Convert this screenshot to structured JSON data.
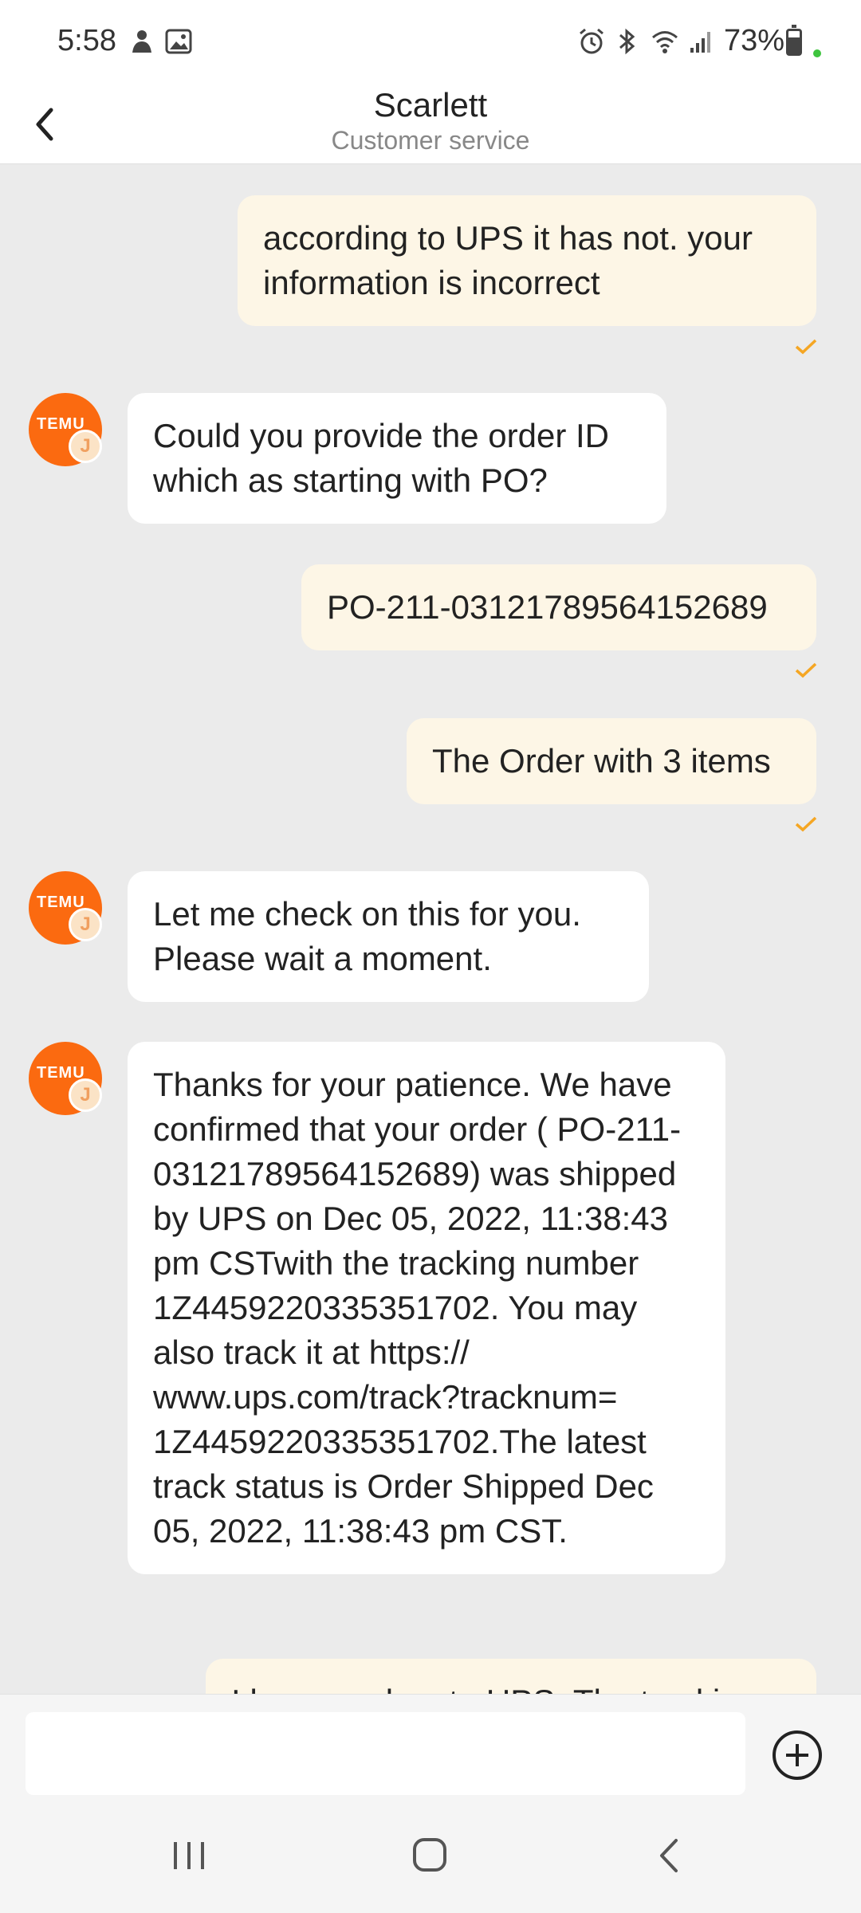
{
  "status_bar": {
    "time": "5:58",
    "battery_percent": "73%",
    "battery_level": 0.73,
    "icons": [
      "notification-icon",
      "image-icon",
      "alarm-icon",
      "bluetooth-icon",
      "wifi-icon",
      "signal-icon",
      "battery-icon"
    ]
  },
  "header": {
    "title": "Scarlett",
    "subtitle": "Customer service"
  },
  "colors": {
    "accent_orange": "#fb6a10",
    "check_color": "#f5a623",
    "outgoing_bubble": "#fdf6e6",
    "incoming_bubble": "#ffffff",
    "chat_background": "#ebebeb"
  },
  "avatar": {
    "logo_text": "TEMU",
    "badge_letter": "J"
  },
  "messages": [
    {
      "side": "out",
      "text": "according to UPS it has not. your information is incorrect",
      "status": "sent"
    },
    {
      "side": "in",
      "text": "Could you provide the order ID which as starting with PO?"
    },
    {
      "side": "out",
      "text": "PO-211-03121789564152689",
      "status": "sent"
    },
    {
      "side": "out",
      "text": "The Order with 3 items",
      "status": "sent"
    },
    {
      "side": "in",
      "text": "Let me check on this for you. Please wait a moment."
    },
    {
      "side": "in",
      "text": "Thanks for your patience. We have confirmed that your order ( PO-211-03121789564152689) was shipped by  UPS on Dec 05, 2022, 11:38:43 pm CSTwith the tracking number 1Z4459220335351702. You may also track it at  https:// www.ups.com/track?tracknum= 1Z4459220335351702.The latest track status is Order Shipped  Dec 05, 2022, 11:38:43 pm CST."
    },
    {
      "side": "out",
      "text": "I have spoken to UPS. The tracking"
    }
  ],
  "input": {
    "value": "",
    "placeholder": ""
  },
  "nav": {
    "buttons": [
      "recent-apps-icon",
      "home-icon",
      "back-icon"
    ]
  }
}
